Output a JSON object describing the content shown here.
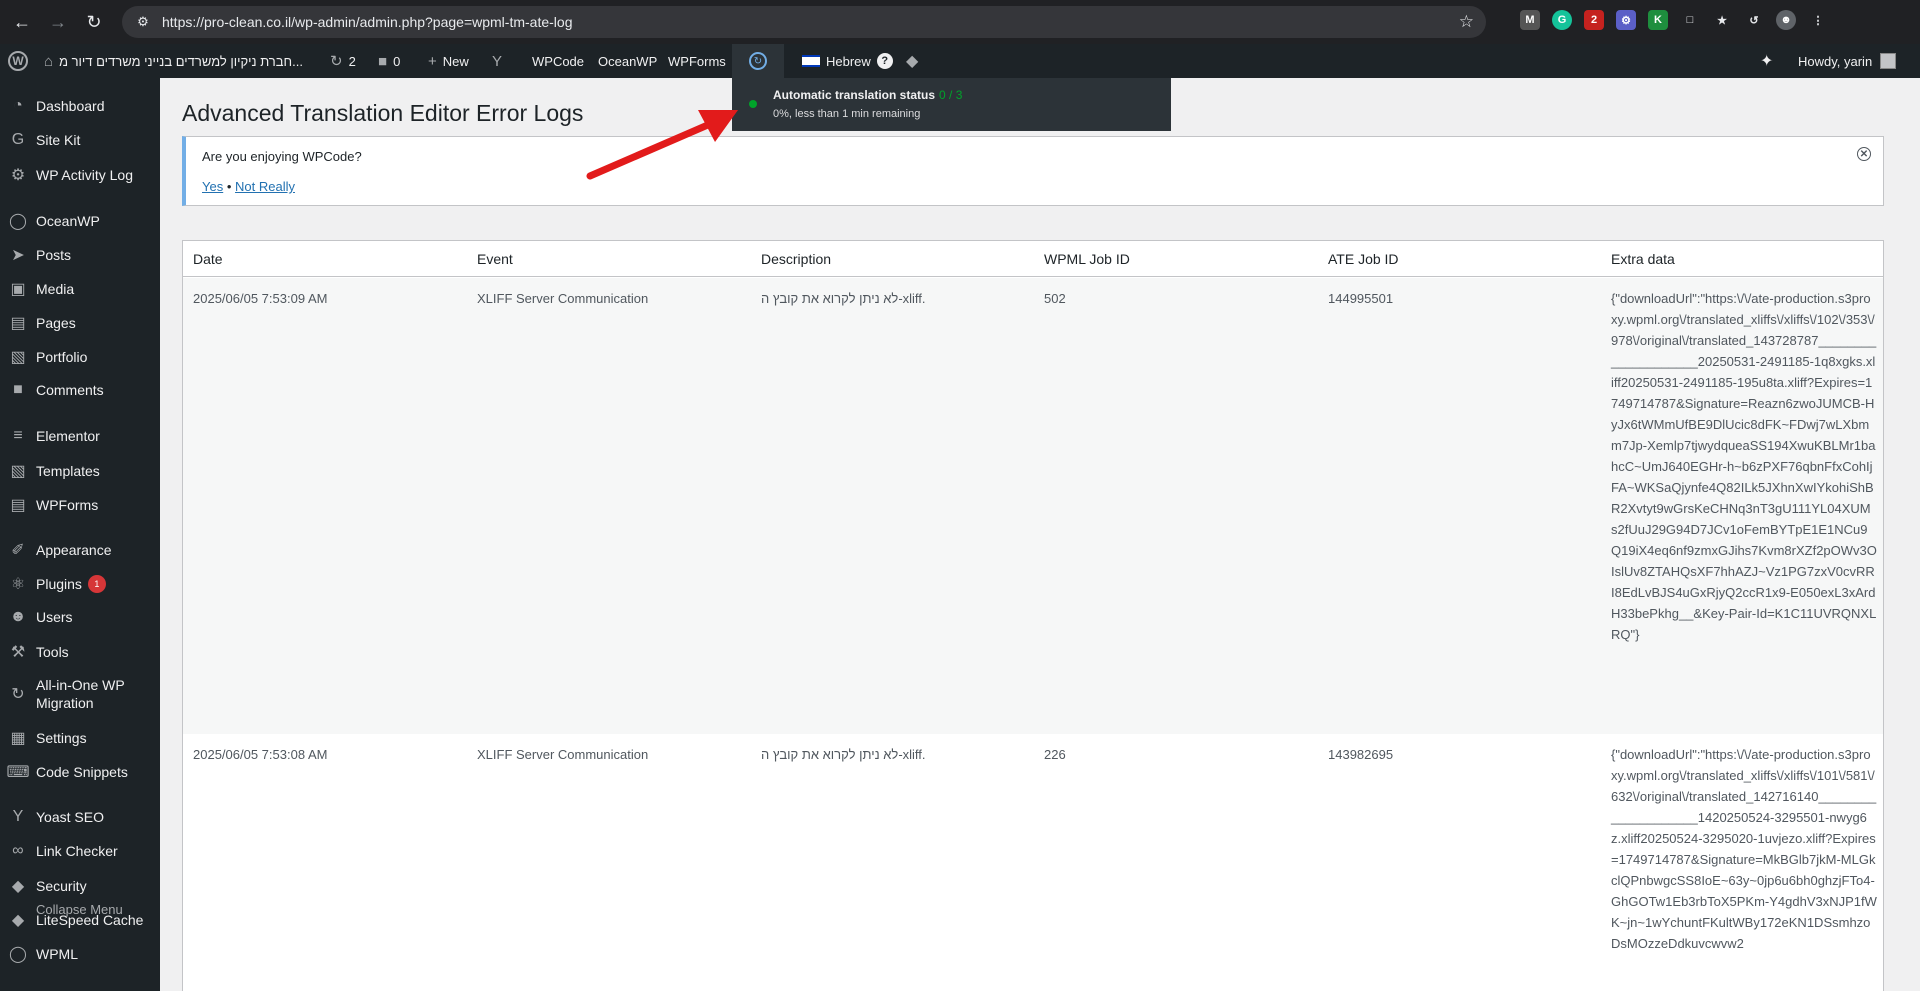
{
  "browser": {
    "url": "https://pro-clean.co.il/wp-admin/admin.php?page=wpml-tm-ate-log",
    "ext_badge": "2"
  },
  "adminbar": {
    "site_name": "חברת ניקיון למשרדים בנייני משרדים דיור מ...",
    "updates_count": "2",
    "comments_count": "0",
    "new_label": "New",
    "wpcode": "WPCode",
    "oceanwp": "OceanWP",
    "wpforms": "WPForms",
    "language": "Hebrew",
    "howdy": "Howdy, yarin"
  },
  "sidebar": {
    "items": [
      {
        "label": "Dashboard",
        "icon": "dashboard-icon"
      },
      {
        "label": "Site Kit",
        "icon": "sitekit-icon"
      },
      {
        "label": "WP Activity Log",
        "icon": "activity-log-icon"
      },
      {
        "label": "OceanWP",
        "icon": "oceanwp-icon"
      },
      {
        "label": "Posts",
        "icon": "pin-icon"
      },
      {
        "label": "Media",
        "icon": "media-icon"
      },
      {
        "label": "Pages",
        "icon": "pages-icon"
      },
      {
        "label": "Portfolio",
        "icon": "folder-icon"
      },
      {
        "label": "Comments",
        "icon": "comment-icon"
      },
      {
        "label": "Elementor",
        "icon": "elementor-icon"
      },
      {
        "label": "Templates",
        "icon": "folder-icon"
      },
      {
        "label": "WPForms",
        "icon": "forms-icon"
      },
      {
        "label": "Appearance",
        "icon": "brush-icon"
      },
      {
        "label": "Plugins",
        "icon": "plugin-icon",
        "badge": "1"
      },
      {
        "label": "Users",
        "icon": "user-icon"
      },
      {
        "label": "Tools",
        "icon": "wrench-icon"
      },
      {
        "label": "All-in-One WP Migration",
        "icon": "migration-icon"
      },
      {
        "label": "Settings",
        "icon": "settings-icon"
      },
      {
        "label": "Code Snippets",
        "icon": "code-icon"
      },
      {
        "label": "Yoast SEO",
        "icon": "yoast-icon"
      },
      {
        "label": "Link Checker",
        "icon": "link-icon"
      },
      {
        "label": "Security",
        "icon": "lock-icon"
      },
      {
        "label": "LiteSpeed Cache",
        "icon": "diamond-icon"
      },
      {
        "label": "WPML",
        "icon": "wpml-icon"
      }
    ],
    "collapse": "Collapse Menu"
  },
  "page": {
    "title": "Advanced Translation Editor Error Logs",
    "notice": {
      "question": "Are you enjoying WPCode?",
      "yes": "Yes",
      "sep": "•",
      "no": "Not Really"
    }
  },
  "table": {
    "headers": [
      "Date",
      "Event",
      "Description",
      "WPML Job ID",
      "ATE Job ID",
      "Extra data"
    ],
    "rows": [
      {
        "date": "2025/06/05 7:53:09 AM",
        "event": "XLIFF Server Communication",
        "description": "לא ניתן לקרוא את קובץ ה-xliff.",
        "wpml_job_id": "502",
        "ate_job_id": "144995501",
        "extra": "{\"downloadUrl\":\"https:\\/\\/ate-production.s3proxy.wpml.org\\/translated_xliffs\\/xliffs\\/102\\/353\\/978\\/original\\/translated_143728787____________________20250531-2491185-1q8xgks.xliff20250531-2491185-195u8ta.xliff?Expires=1749714787&Signature=Reazn6zwoJUMCB-HyJx6tWMmUfBE9DlUcic8dFK~FDwj7wLXbmm7Jp-Xemlp7tjwydqueaSS194XwuKBLMr1bahcC~UmJ640EGHr-h~b6zPXF76qbnFfxCohIjFA~WKSaQjynfe4Q82ILk5JXhnXwIYkohiShBR2Xvtyt9wGrsKeCHNq3nT3gU111YL04XUMs2fUuJ29G94D7JCv1oFemBYTpE1E1NCu9Q19iX4eq6nf9zmxGJihs7Kvm8rXZf2pOWv3OIslUv8ZTAHQsXF7hhAZJ~Vz1PG7zxV0cvRRI8EdLvBJS4uGxRjyQ2ccR1x9-E050exL3xArdH33bePkhg__&Key-Pair-Id=K1C11UVRQNXLRQ\"}"
      },
      {
        "date": "2025/06/05 7:53:08 AM",
        "event": "XLIFF Server Communication",
        "description": "לא ניתן לקרוא את קובץ ה-xliff.",
        "wpml_job_id": "226",
        "ate_job_id": "143982695",
        "extra": "{\"downloadUrl\":\"https:\\/\\/ate-production.s3proxy.wpml.org\\/translated_xliffs\\/xliffs\\/101\\/581\\/632\\/original\\/translated_142716140____________________1420250524-3295501-nwyg6z.xliff20250524-3295020-1uvjezo.xliff?Expires=1749714787&Signature=MkBGlb7jkM-MLGkclQPnbwgcSS8IoE~63y~0jp6u6bh0ghzjFTo4-GhGOTw1Eb3rbToX5PKm-Y4gdhV3xNJP1fWK~jn~1wYchuntFKultWBy172eKN1DSsmhzoDsMOzzeDdkuvcwvw2"
      }
    ]
  },
  "popup": {
    "title": "Automatic translation status",
    "count": "0 / 3",
    "subtitle": "0%, less than 1 min remaining"
  }
}
